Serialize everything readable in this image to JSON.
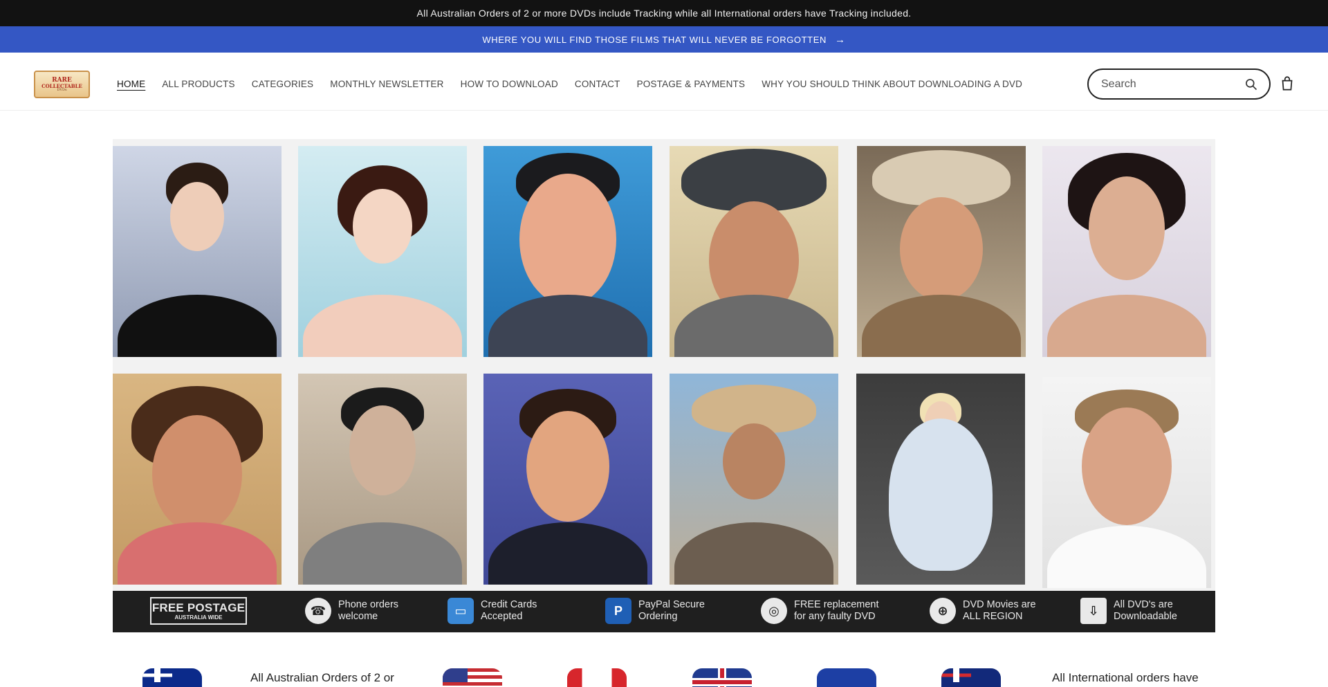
{
  "announcement": {
    "top_text": "All Australian Orders of 2 or more DVDs include Tracking while all International orders have Tracking included.",
    "promo_text": "WHERE YOU WILL FIND THOSE FILMS THAT WILL NEVER BE FORGOTTEN",
    "promo_arrow": "→"
  },
  "logo": {
    "line1": "RARE",
    "line2": "COLLECTABLE",
    "line3": "DVDs"
  },
  "nav": {
    "items": [
      {
        "label": "HOME",
        "active": true
      },
      {
        "label": "ALL PRODUCTS"
      },
      {
        "label": "CATEGORIES"
      },
      {
        "label": "MONTHLY NEWSLETTER"
      },
      {
        "label": "HOW TO DOWNLOAD"
      },
      {
        "label": "CONTACT"
      },
      {
        "label": "POSTAGE & PAYMENTS"
      },
      {
        "label": "WHY YOU SHOULD THINK ABOUT DOWNLOADING A DVD"
      }
    ]
  },
  "search": {
    "placeholder": "Search"
  },
  "features": {
    "free_postage_title": "FREE POSTAGE",
    "free_postage_sub": "AUSTRALIA WIDE",
    "items": [
      {
        "line1": "Phone orders",
        "line2": "welcome",
        "icon": "phone-icon"
      },
      {
        "line1": "Credit Cards",
        "line2": "Accepted",
        "icon": "credit-card-icon"
      },
      {
        "line1": "PayPal Secure",
        "line2": "Ordering",
        "icon": "paypal-icon"
      },
      {
        "line1": "FREE replacement",
        "line2": "for any faulty DVD",
        "icon": "disc-icon"
      },
      {
        "line1": "DVD Movies are",
        "line2": "ALL REGION",
        "icon": "globe-icon"
      },
      {
        "line1": "All DVD's are",
        "line2": "Downloadable",
        "icon": "download-icon"
      }
    ]
  },
  "shipping_strip": {
    "left_text": "All Australian Orders of 2 or",
    "right_text": "All International orders have"
  }
}
